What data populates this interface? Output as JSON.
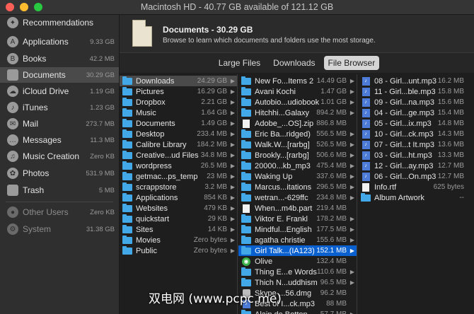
{
  "window": {
    "title": "Macintosh HD - 40.77 GB available of 121.12 GB"
  },
  "sidebar": {
    "items": [
      {
        "label": "Recommendations",
        "size": "",
        "icon": "lightbulb-icon"
      },
      {
        "label": "Applications",
        "size": "9.33 GB",
        "icon": "app-store-icon"
      },
      {
        "label": "Books",
        "size": "42.2 MB",
        "icon": "book-icon"
      },
      {
        "label": "Documents",
        "size": "30.29 GB",
        "icon": "document-icon"
      },
      {
        "label": "iCloud Drive",
        "size": "1.19 GB",
        "icon": "cloud-icon"
      },
      {
        "label": "iTunes",
        "size": "1.23 GB",
        "icon": "music-note-icon"
      },
      {
        "label": "Mail",
        "size": "273.7 MB",
        "icon": "mail-icon"
      },
      {
        "label": "Messages",
        "size": "11.3 MB",
        "icon": "chat-bubble-icon"
      },
      {
        "label": "Music Creation",
        "size": "Zero KB",
        "icon": "guitar-icon"
      },
      {
        "label": "Photos",
        "size": "531.9 MB",
        "icon": "photos-icon"
      },
      {
        "label": "Trash",
        "size": "5 MB",
        "icon": "trash-icon"
      }
    ],
    "other": [
      {
        "label": "Other Users",
        "size": "Zero KB",
        "icon": "users-icon"
      },
      {
        "label": "System",
        "size": "31.38 GB",
        "icon": "system-icon"
      }
    ]
  },
  "header": {
    "title": "Documents - 30.29 GB",
    "subtitle": "Browse to learn which documents and folders use the most storage."
  },
  "tabs": [
    "Large Files",
    "Downloads",
    "File Browser"
  ],
  "columns": [
    {
      "rows": [
        {
          "name": "Downloads",
          "size": "24.29 GB",
          "type": "folder"
        },
        {
          "name": "Pictures",
          "size": "16.29 GB",
          "type": "folder"
        },
        {
          "name": "Dropbox",
          "size": "2.21 GB",
          "type": "folder"
        },
        {
          "name": "Music",
          "size": "1.64 GB",
          "type": "folder"
        },
        {
          "name": "Documents",
          "size": "1.49 GB",
          "type": "folder"
        },
        {
          "name": "Desktop",
          "size": "233.4 MB",
          "type": "folder"
        },
        {
          "name": "Calibre Library",
          "size": "184.2 MB",
          "type": "folder"
        },
        {
          "name": "Creative...ud Files",
          "size": "34.8 MB",
          "type": "folder"
        },
        {
          "name": "wordpress",
          "size": "26.5 MB",
          "type": "folder"
        },
        {
          "name": "getmac...ps_temp",
          "size": "23 MB",
          "type": "folder"
        },
        {
          "name": "scrappstore",
          "size": "3.2 MB",
          "type": "folder"
        },
        {
          "name": "Applications",
          "size": "854 KB",
          "type": "folder"
        },
        {
          "name": "Websites",
          "size": "479 KB",
          "type": "folder"
        },
        {
          "name": "quickstart",
          "size": "29 KB",
          "type": "folder"
        },
        {
          "name": "Sites",
          "size": "14 KB",
          "type": "folder"
        },
        {
          "name": "Movies",
          "size": "Zero bytes",
          "type": "folder"
        },
        {
          "name": "Public",
          "size": "Zero bytes",
          "type": "folder"
        }
      ]
    },
    {
      "rows": [
        {
          "name": "New Fo...Items 2",
          "size": "14.49 GB",
          "type": "folder"
        },
        {
          "name": "Avani Kochi",
          "size": "1.47 GB",
          "type": "folder"
        },
        {
          "name": "Autobio...udiobook",
          "size": "1.01 GB",
          "type": "folder"
        },
        {
          "name": "Hitchhi...Galaxy",
          "size": "894.2 MB",
          "type": "folder"
        },
        {
          "name": "Adobe_...OS].zip",
          "size": "886.8 MB",
          "type": "file"
        },
        {
          "name": "Eric Ba...ridged)",
          "size": "556.5 MB",
          "type": "folder"
        },
        {
          "name": "Walk.W...[rarbg]",
          "size": "526.5 MB",
          "type": "folder"
        },
        {
          "name": "Brookly...[rarbg]",
          "size": "506.6 MB",
          "type": "folder"
        },
        {
          "name": "20000...kb_mp3",
          "size": "475.4 MB",
          "type": "folder"
        },
        {
          "name": "Waking Up",
          "size": "337.6 MB",
          "type": "folder"
        },
        {
          "name": "Marcus...itations",
          "size": "296.5 MB",
          "type": "folder"
        },
        {
          "name": "wetran...-629ffc",
          "size": "234.8 MB",
          "type": "folder"
        },
        {
          "name": "When...m4b.part",
          "size": "219.4 MB",
          "type": "file"
        },
        {
          "name": "Viktor E. Frankl",
          "size": "178.2 MB",
          "type": "folder"
        },
        {
          "name": "Mindful...English",
          "size": "177.5 MB",
          "type": "folder"
        },
        {
          "name": "agatha christie",
          "size": "155.6 MB",
          "type": "folder"
        },
        {
          "name": "Girl Talk...(IA123)",
          "size": "152.1 MB",
          "type": "folder"
        },
        {
          "name": "Olive",
          "size": "132.4 MB",
          "type": "app"
        },
        {
          "name": "Thing E...e Words",
          "size": "110.6 MB",
          "type": "folder"
        },
        {
          "name": "Thich N...uddhism",
          "size": "96.5 MB",
          "type": "folder"
        },
        {
          "name": "Skype-...56.dmg",
          "size": "96.2 MB",
          "type": "disk"
        },
        {
          "name": "Best of I...ck.mp3",
          "size": "88 MB",
          "type": "audio"
        },
        {
          "name": "Alain de Botton",
          "size": "57.7 MB",
          "type": "folder"
        }
      ]
    },
    {
      "rows": [
        {
          "name": "08 - Girl...unt.mp3",
          "size": "16.2 MB",
          "type": "audio"
        },
        {
          "name": "11 - Girl...ble.mp3",
          "size": "15.8 MB",
          "type": "audio"
        },
        {
          "name": "09 - Girl...na.mp3",
          "size": "15.6 MB",
          "type": "audio"
        },
        {
          "name": "04 - Girl...ge.mp3",
          "size": "15.4 MB",
          "type": "audio"
        },
        {
          "name": "05 - Girl...ix.mp3",
          "size": "14.8 MB",
          "type": "audio"
        },
        {
          "name": "10 - Girl...ck.mp3",
          "size": "14.3 MB",
          "type": "audio"
        },
        {
          "name": "07 - Girl...t It.mp3",
          "size": "13.6 MB",
          "type": "audio"
        },
        {
          "name": "03 - Girl...ht.mp3",
          "size": "13.3 MB",
          "type": "audio"
        },
        {
          "name": "12 - Girl...ay.mp3",
          "size": "12.7 MB",
          "type": "audio"
        },
        {
          "name": "06 - Girl...On.mp3",
          "size": "12.7 MB",
          "type": "audio"
        },
        {
          "name": "Info.rtf",
          "size": "625 bytes",
          "type": "file"
        },
        {
          "name": "Album Artwork",
          "size": "--",
          "type": "folder"
        }
      ]
    }
  ],
  "watermark": "双电网 (www.pcpc.me)"
}
